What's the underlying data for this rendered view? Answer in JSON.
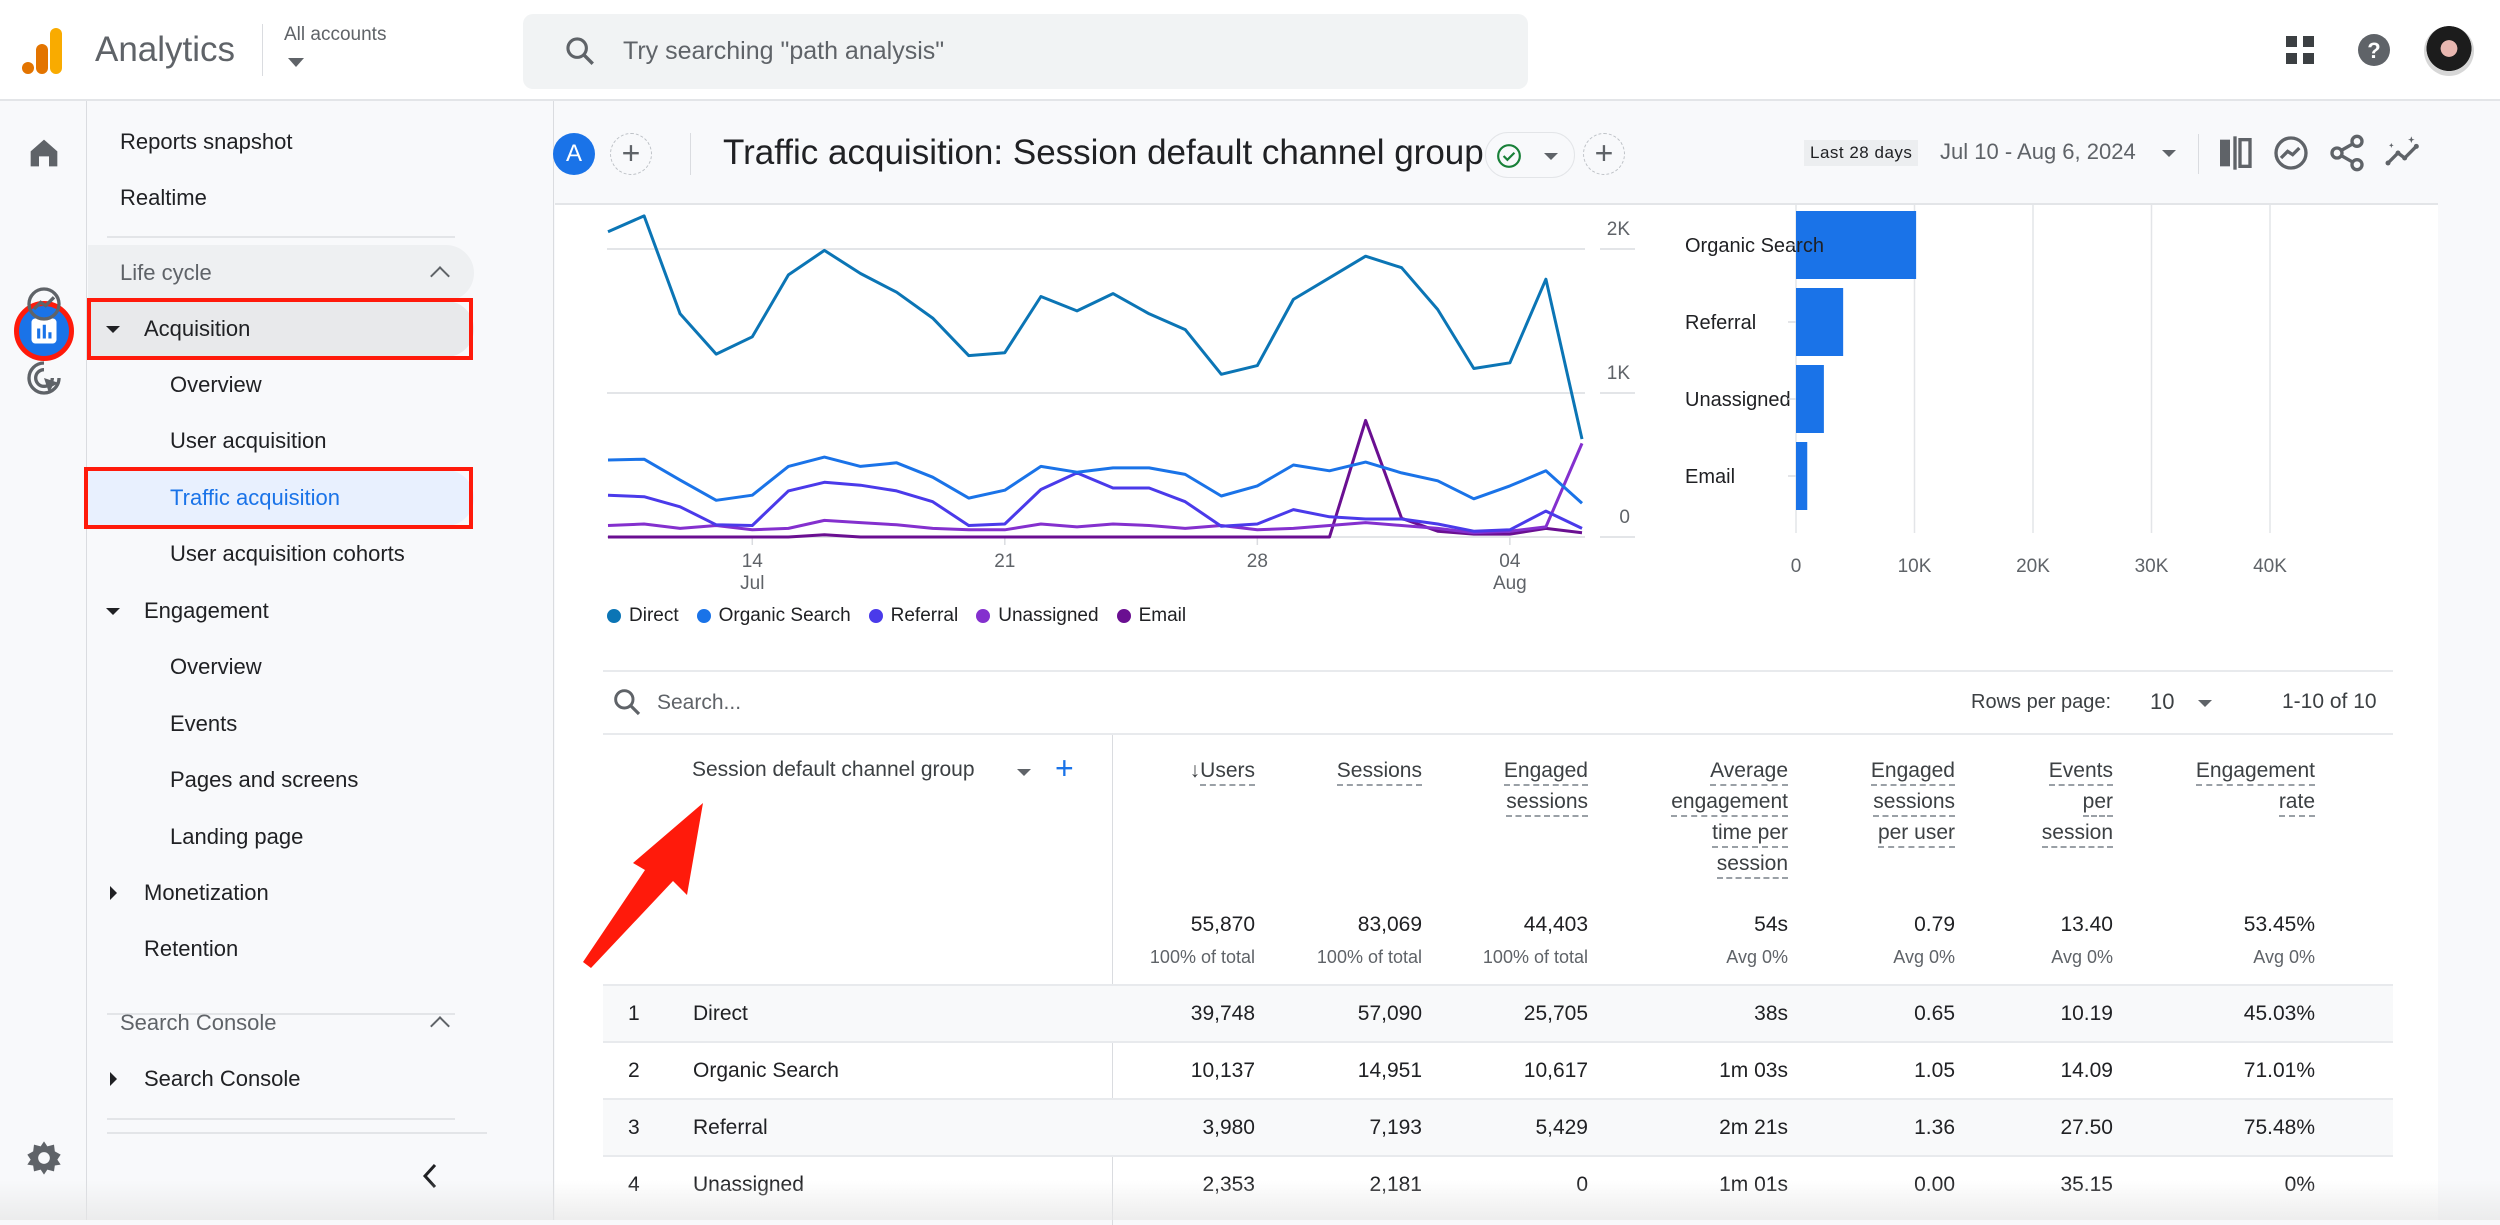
{
  "topbar": {
    "app_title": "Analytics",
    "account_label": "All accounts",
    "search_placeholder": "Try searching \"path analysis\"",
    "icons": [
      "apps-grid-icon",
      "help-icon",
      "account-avatar"
    ]
  },
  "rail": {
    "items": [
      {
        "name": "home",
        "icon": "home-icon",
        "active": false
      },
      {
        "name": "reports",
        "icon": "reports-icon",
        "active": true
      },
      {
        "name": "explore",
        "icon": "explore-icon",
        "active": false
      },
      {
        "name": "advertising",
        "icon": "advertising-icon",
        "active": false
      },
      {
        "name": "admin",
        "icon": "gear-icon",
        "active": false
      }
    ]
  },
  "nav": {
    "top_items": [
      "Reports snapshot",
      "Realtime"
    ],
    "lifecycle_section": "Life cycle",
    "acquisition": {
      "label": "Acquisition",
      "children": [
        "Overview",
        "User acquisition",
        "Traffic acquisition",
        "User acquisition cohorts"
      ],
      "selected": "Traffic acquisition"
    },
    "engagement": {
      "label": "Engagement",
      "children": [
        "Overview",
        "Events",
        "Pages and screens",
        "Landing page"
      ]
    },
    "monetization": "Monetization",
    "retention": "Retention",
    "search_console_section": "Search Console",
    "search_console_item": "Search Console",
    "collapse_label": "<"
  },
  "header": {
    "comparison_avatar": "A",
    "title": "Traffic acquisition: Session default channel group",
    "range_chip": "Last 28 days",
    "date_range": "Jul 10 - Aug 6, 2024"
  },
  "colors": {
    "accent": "#1a73e8",
    "direct": "#0b75b5",
    "organic_search": "#1a73e8",
    "referral": "#4a3aea",
    "unassigned": "#8430ce",
    "email": "#6a0f91",
    "annotation": "#ff1a0b"
  },
  "chart_data": [
    {
      "type": "line",
      "title": "",
      "xlabel": "",
      "ylabel": "",
      "x": [
        "Jul 10",
        "Jul 11",
        "Jul 12",
        "Jul 13",
        "Jul 14",
        "Jul 15",
        "Jul 16",
        "Jul 17",
        "Jul 18",
        "Jul 19",
        "Jul 20",
        "Jul 21",
        "Jul 22",
        "Jul 23",
        "Jul 24",
        "Jul 25",
        "Jul 26",
        "Jul 27",
        "Jul 28",
        "Jul 29",
        "Jul 30",
        "Jul 31",
        "Aug 1",
        "Aug 2",
        "Aug 3",
        "Aug 4",
        "Aug 5",
        "Aug 6"
      ],
      "x_ticks": [
        {
          "index": 4,
          "label": "14",
          "sub": "Jul"
        },
        {
          "index": 11,
          "label": "21",
          "sub": ""
        },
        {
          "index": 18,
          "label": "28",
          "sub": ""
        },
        {
          "index": 25,
          "label": "04",
          "sub": "Aug"
        }
      ],
      "y_ticks": [
        {
          "value": 0,
          "label": "0"
        },
        {
          "value": 1000,
          "label": "1K"
        },
        {
          "value": 2000,
          "label": "2K"
        }
      ],
      "ylim": [
        0,
        2350
      ],
      "grid": true,
      "legend": "bottom-left",
      "series": [
        {
          "name": "Direct",
          "color": "#0b75b5",
          "values": [
            2120,
            2230,
            1550,
            1270,
            1390,
            1820,
            1990,
            1830,
            1700,
            1520,
            1260,
            1280,
            1670,
            1570,
            1690,
            1550,
            1440,
            1130,
            1190,
            1650,
            1800,
            1950,
            1870,
            1580,
            1170,
            1210,
            1790,
            680
          ]
        },
        {
          "name": "Organic Search",
          "color": "#1a73e8",
          "values": [
            535,
            540,
            395,
            255,
            290,
            490,
            555,
            490,
            515,
            415,
            270,
            325,
            490,
            450,
            480,
            480,
            435,
            285,
            355,
            500,
            460,
            520,
            445,
            390,
            265,
            355,
            460,
            235
          ]
        },
        {
          "name": "Referral",
          "color": "#4a3aea",
          "values": [
            290,
            280,
            210,
            85,
            80,
            320,
            380,
            360,
            320,
            245,
            80,
            90,
            330,
            445,
            340,
            340,
            245,
            75,
            90,
            190,
            140,
            125,
            125,
            90,
            40,
            50,
            180,
            60
          ]
        },
        {
          "name": "Unassigned",
          "color": "#8430ce",
          "values": [
            80,
            90,
            60,
            80,
            50,
            60,
            115,
            100,
            85,
            60,
            50,
            50,
            90,
            70,
            90,
            80,
            60,
            80,
            50,
            60,
            80,
            100,
            80,
            60,
            30,
            40,
            70,
            650
          ]
        },
        {
          "name": "Email",
          "color": "#6a0f91",
          "values": [
            0,
            0,
            0,
            0,
            0,
            0,
            15,
            0,
            0,
            0,
            0,
            0,
            0,
            0,
            0,
            0,
            0,
            0,
            0,
            0,
            0,
            810,
            130,
            40,
            20,
            20,
            60,
            30
          ]
        }
      ]
    },
    {
      "type": "bar",
      "orientation": "horizontal",
      "title": "",
      "categories": [
        "Organic Search",
        "Referral",
        "Unassigned",
        "Email"
      ],
      "values": [
        10137,
        3980,
        2353,
        950
      ],
      "xlim": [
        0,
        40000
      ],
      "x_ticks": [
        "0",
        "10K",
        "20K",
        "30K",
        "40K"
      ],
      "grid": true,
      "color": "#1a73e8"
    }
  ],
  "table": {
    "search_placeholder": "Search...",
    "rows_per_page_label": "Rows per page:",
    "rows_per_page": "10",
    "pagination": "1-10 of 10",
    "dimension_header": "Session default channel group",
    "metric_headers": [
      {
        "lines": [
          "Users"
        ],
        "sorted": true
      },
      {
        "lines": [
          "Sessions"
        ]
      },
      {
        "lines": [
          "Engaged",
          "sessions"
        ]
      },
      {
        "lines": [
          "Average",
          "engagement",
          "time per",
          "session"
        ]
      },
      {
        "lines": [
          "Engaged",
          "sessions",
          "per user"
        ]
      },
      {
        "lines": [
          "Events",
          "per",
          "session"
        ]
      },
      {
        "lines": [
          "Engagement",
          "rate"
        ]
      }
    ],
    "totals": [
      "55,870",
      "83,069",
      "44,403",
      "54s",
      "0.79",
      "13.40",
      "53.45%"
    ],
    "totals_sub": [
      "100% of total",
      "100% of total",
      "100% of total",
      "Avg 0%",
      "Avg 0%",
      "Avg 0%",
      "Avg 0%"
    ],
    "rows": [
      {
        "index": "1",
        "name": "Direct",
        "values": [
          "39,748",
          "57,090",
          "25,705",
          "38s",
          "0.65",
          "10.19",
          "45.03%"
        ]
      },
      {
        "index": "2",
        "name": "Organic Search",
        "values": [
          "10,137",
          "14,951",
          "10,617",
          "1m 03s",
          "1.05",
          "14.09",
          "71.01%"
        ]
      },
      {
        "index": "3",
        "name": "Referral",
        "values": [
          "3,980",
          "7,193",
          "5,429",
          "2m 21s",
          "1.36",
          "27.50",
          "75.48%"
        ]
      },
      {
        "index": "4",
        "name": "Unassigned",
        "values": [
          "2,353",
          "2,181",
          "0",
          "1m 01s",
          "0.00",
          "35.15",
          "0%"
        ]
      }
    ]
  }
}
